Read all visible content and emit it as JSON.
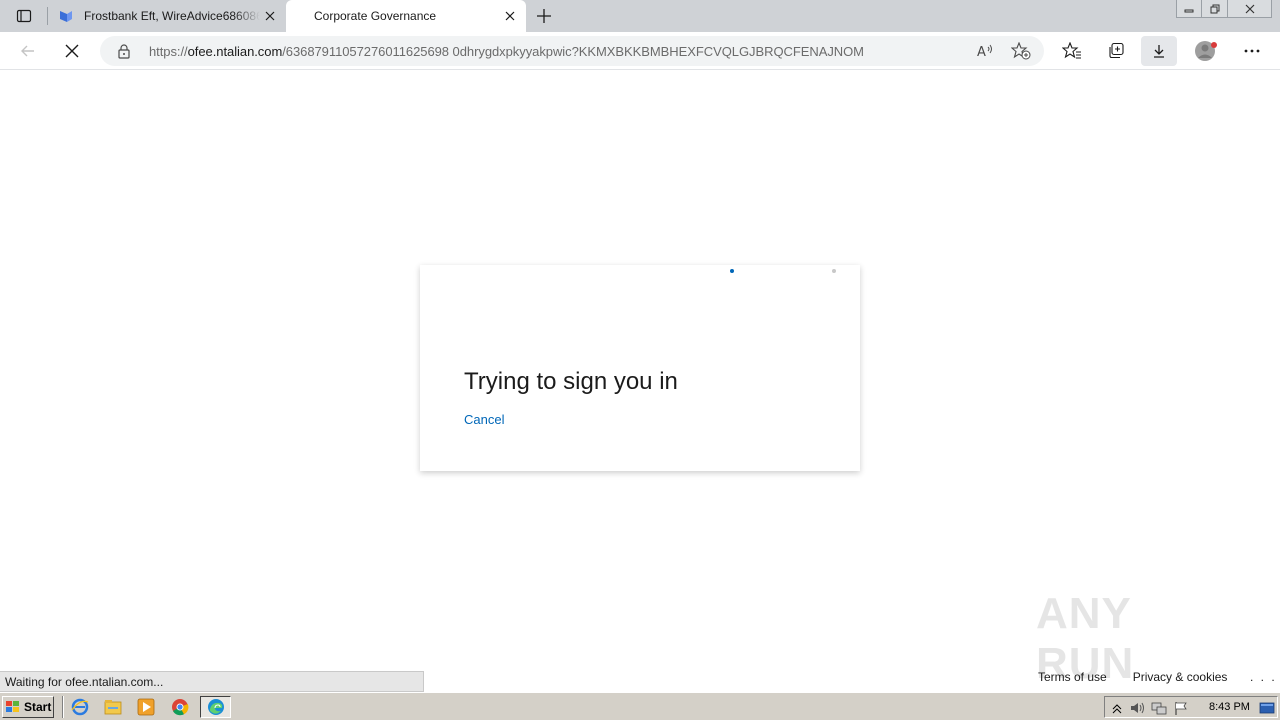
{
  "browser": {
    "tabs": [
      {
        "title": "Frostbank Eft, WireAdvice686086",
        "active": false
      },
      {
        "title": "Corporate Governance",
        "active": true
      }
    ],
    "address": {
      "scheme": "https://",
      "host": "ofee.ntalian.com",
      "path": "/63687911057276011625698 0dhrygdxpkyyakpwic?KKMXBKKBMBHEXFCVQLGJBRQCFENAJNOM"
    }
  },
  "signin": {
    "title": "Trying to sign you in",
    "cancel_label": "Cancel"
  },
  "status_text": "Waiting for ofee.ntalian.com...",
  "footer": {
    "terms": "Terms of use",
    "privacy": "Privacy & cookies",
    "more": ". . ."
  },
  "watermark": {
    "text": "ANY RUN"
  },
  "taskbar": {
    "start_label": "Start",
    "clock": "8:43 PM"
  },
  "colors": {
    "accent": "#0067b8",
    "tabstrip": "#cfd2d6",
    "taskbar": "#d4d0c8"
  }
}
